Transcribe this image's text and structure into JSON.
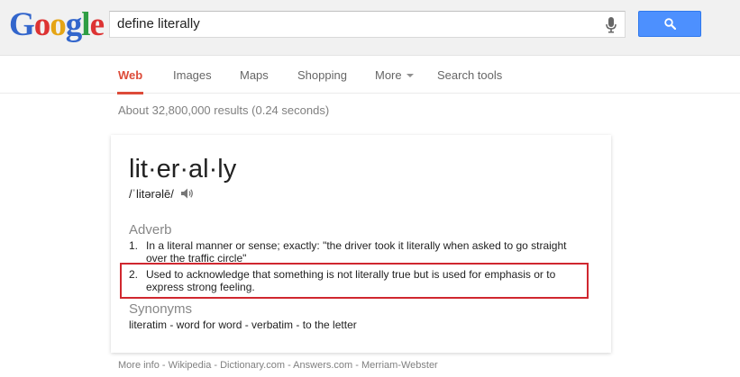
{
  "logo": {
    "text": "Google",
    "letters": [
      {
        "char": "G",
        "color": "#3366cc"
      },
      {
        "char": "o",
        "color": "#dd3333"
      },
      {
        "char": "o",
        "color": "#e5a515"
      },
      {
        "char": "g",
        "color": "#3366cc"
      },
      {
        "char": "l",
        "color": "#2f9e44"
      },
      {
        "char": "e",
        "color": "#dd3333"
      }
    ]
  },
  "search": {
    "value": "define literally",
    "mic_icon": "microphone-icon",
    "button_icon": "magnifier-icon"
  },
  "tabs": [
    {
      "label": "Web",
      "active": true
    },
    {
      "label": "Images",
      "active": false
    },
    {
      "label": "Maps",
      "active": false
    },
    {
      "label": "Shopping",
      "active": false
    },
    {
      "label": "More",
      "active": false
    },
    {
      "label": "Search tools",
      "active": false
    }
  ],
  "result_stats": "About 32,800,000 results (0.24 seconds)",
  "definition": {
    "headword": "lit·er·al·ly",
    "pronunciation": "/ˈlitərəlē/",
    "speaker_icon": "speaker-icon",
    "part_of_speech": "Adverb",
    "senses": [
      {
        "num": "1.",
        "text": "In a literal manner or sense; exactly: \"the driver took it literally when asked to go straight over the traffic circle\""
      },
      {
        "num": "2.",
        "text": "Used to acknowledge that something is not literally true but is used for emphasis or to express strong feeling."
      }
    ],
    "synonyms_label": "Synonyms",
    "synonyms": "literatim - word for word - verbatim - to the letter"
  },
  "more_info": "More info - Wikipedia - Dictionary.com - Answers.com - Merriam-Webster",
  "colors": {
    "accent_red": "#dd4b39",
    "button_blue": "#4d90fe",
    "highlight_box": "#d0272f"
  }
}
